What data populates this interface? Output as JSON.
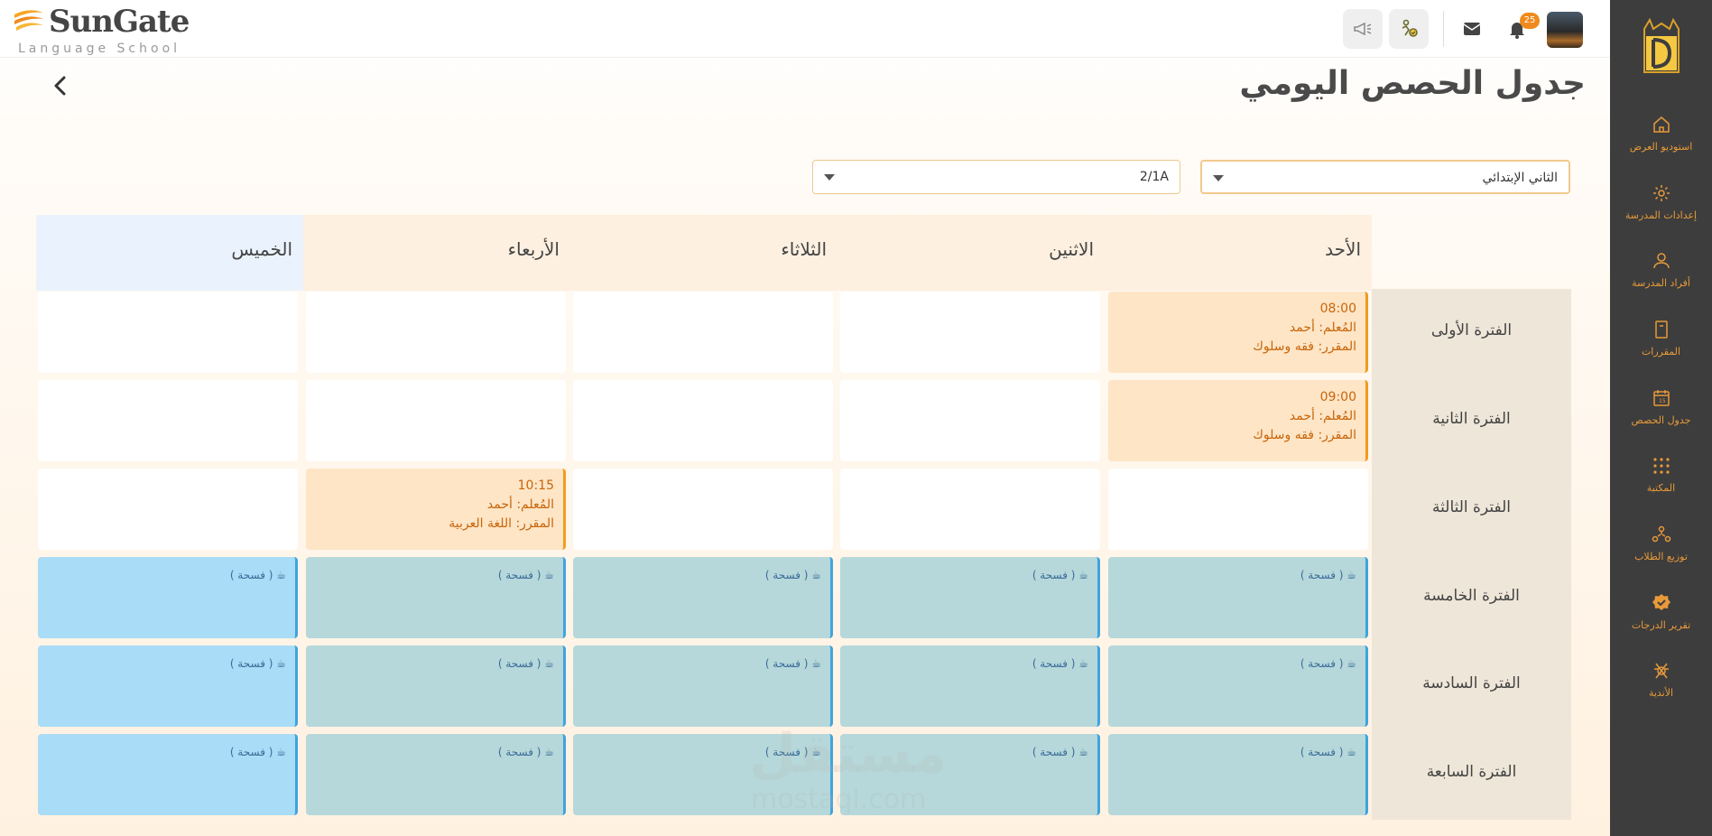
{
  "brand": {
    "name": "SunGate",
    "subtitle": "Language School"
  },
  "header": {
    "notification_count": "25"
  },
  "sidebar": {
    "items": [
      {
        "label": "استوديو العرض",
        "icon": "home-icon"
      },
      {
        "label": "إعدادات المدرسة",
        "icon": "gear-icon"
      },
      {
        "label": "أفراد المدرسة",
        "icon": "person-icon"
      },
      {
        "label": "المقررات",
        "icon": "book-icon"
      },
      {
        "label": "جدول الحصص",
        "icon": "calendar-icon"
      },
      {
        "label": "المكتبة",
        "icon": "grid-icon"
      },
      {
        "label": "توزيع الطلاب",
        "icon": "students-icon"
      },
      {
        "label": "تقرير الدرجات",
        "icon": "badge-check-icon"
      },
      {
        "label": "الأندية",
        "icon": "club-icon"
      }
    ],
    "accent": "#e89a3a"
  },
  "page": {
    "title": "جدول الحصص اليومي"
  },
  "filters": {
    "grade": "الثاني الإبتدائي",
    "class": "2/1A"
  },
  "timetable": {
    "days": [
      "الأحد",
      "الاثنين",
      "الثلاثاء",
      "الأربعاء",
      "الخميس"
    ],
    "periods": [
      "الفترة الأولى",
      "الفترة الثانية",
      "الفترة الثالثة",
      "الفترة  الخامسة",
      "الفترة السادسة",
      "الفترة السابعة"
    ],
    "lessons": [
      {
        "time": "08:00",
        "teacher": "المُعلم: أحمد",
        "course": "المقرر: فقه وسلوك"
      },
      {
        "time": "09:00",
        "teacher": "المُعلم: أحمد",
        "course": "المقرر: فقه وسلوك"
      },
      {
        "time": "10:15",
        "teacher": "المُعلم: أحمد",
        "course": "المقرر: اللغة العربية"
      }
    ],
    "break_label": "☕ ( فسحة )"
  },
  "watermark": {
    "text": "مستقل",
    "sub": "mostaql.com"
  },
  "colors": {
    "lesson_bg": "#fde5c6",
    "lesson_border": "#f29b1d",
    "break_bg": "#b6d8da",
    "break_border": "#3ea4de",
    "sidebar_bg": "#3d3d3d"
  }
}
